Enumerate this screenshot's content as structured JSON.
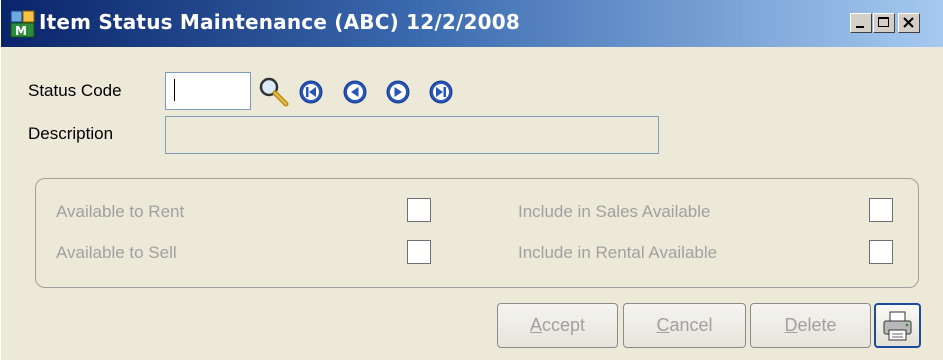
{
  "window": {
    "title": "Item Status Maintenance (ABC) 12/2/2008",
    "controls": {
      "minimize": "minimize",
      "maximize": "maximize",
      "close": "close"
    }
  },
  "form": {
    "status_code_label": "Status Code",
    "status_code_value": "",
    "description_label": "Description",
    "description_value": ""
  },
  "options": {
    "available_to_rent": {
      "label": "Available to Rent",
      "checked": false
    },
    "available_to_sell": {
      "label": "Available to Sell",
      "checked": false
    },
    "include_in_sales": {
      "label": "Include in Sales Available",
      "checked": false
    },
    "include_in_rental": {
      "label": "Include in Rental Available",
      "checked": false
    }
  },
  "buttons": {
    "accept": {
      "mnemonic": "A",
      "rest": "ccept"
    },
    "cancel": {
      "mnemonic": "C",
      "rest": "ancel"
    },
    "delete": {
      "mnemonic": "D",
      "rest": "elete"
    }
  },
  "icons": {
    "lookup": "magnifier-icon",
    "nav": [
      "first-record-icon",
      "previous-record-icon",
      "next-record-icon",
      "last-record-icon"
    ],
    "print": "printer-icon",
    "app": "app-icon"
  },
  "colors": {
    "title_start": "#0a246a",
    "title_end": "#a6caf0",
    "nav_blue": "#2a55b8",
    "disabled_text": "#a0a0a0"
  }
}
